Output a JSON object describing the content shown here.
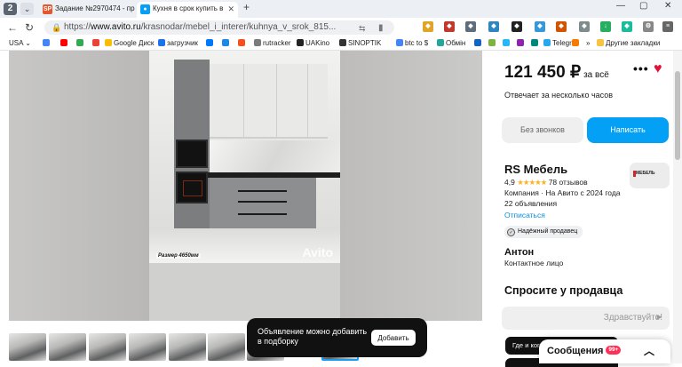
{
  "browser": {
    "tab_count": "2",
    "tabs": [
      {
        "label": "Задание №2970474 - про",
        "favicon": "SP",
        "active": false
      },
      {
        "label": "Кухня в срок купить в",
        "favicon": "avito-favicon",
        "active": true
      }
    ],
    "url_domain": "www.avito.ru",
    "url_path": "/krasnodar/mebel_i_interer/kuhnya_v_srok_815...",
    "url_prefix": "https://",
    "bookmarks": [
      {
        "label": "USA",
        "color": "#888888"
      },
      {
        "label": "",
        "color": "#4285f4"
      },
      {
        "label": "",
        "color": "#ff0000"
      },
      {
        "label": "",
        "color": "#34a853"
      },
      {
        "label": "Google Диск",
        "color": "#fbbc04"
      },
      {
        "label": "загрузчик",
        "color": "#1a73e8"
      },
      {
        "label": "",
        "color": "#0077ff"
      },
      {
        "label": "",
        "color": "#1e88e5"
      },
      {
        "label": "",
        "color": "#f4511e"
      },
      {
        "label": "rutracker",
        "color": "#7b7b7b"
      },
      {
        "label": "UAKino",
        "color": "#222222"
      },
      {
        "label": "SINOPTIK",
        "color": "#333333"
      },
      {
        "label": "btc to $",
        "color": "#4285f4"
      },
      {
        "label": "Обмін",
        "color": "#26a69a"
      },
      {
        "label": "Telegr",
        "color": "#29a9eb"
      },
      {
        "label": "Другие закладки",
        "color": "#f6c343"
      }
    ]
  },
  "listing": {
    "price": "121 450 ₽",
    "price_suffix": "за всё",
    "reply_time": "Отвечает за несколько часов",
    "btn_calls": "Без звонков",
    "btn_write": "Написать",
    "photo_caption": "Размер 4650мм",
    "watermark": "Avito"
  },
  "seller": {
    "name": "RS Мебель",
    "rating": "4,9",
    "stars": "★★★★★",
    "reviews": "78 отзывов",
    "company": "Компания · На Авито с 2024 года",
    "ads_count": "22 объявления",
    "subscribe": "Отписаться",
    "badge": "Надёжный продавец",
    "logo_text": "МЕБЕЛЬ"
  },
  "contact": {
    "name": "Антон",
    "role": "Контактное лицо"
  },
  "ask": {
    "title": "Спросите у продавца",
    "input_value": "Здравствуйте!",
    "chip": "Где и когда можно посмотреть?"
  },
  "toast": {
    "text_line1": "Объявление можно добавить",
    "text_line2": "в подборку",
    "button": "Добавить"
  },
  "messages": {
    "label": "Сообщения",
    "count": "99+"
  }
}
